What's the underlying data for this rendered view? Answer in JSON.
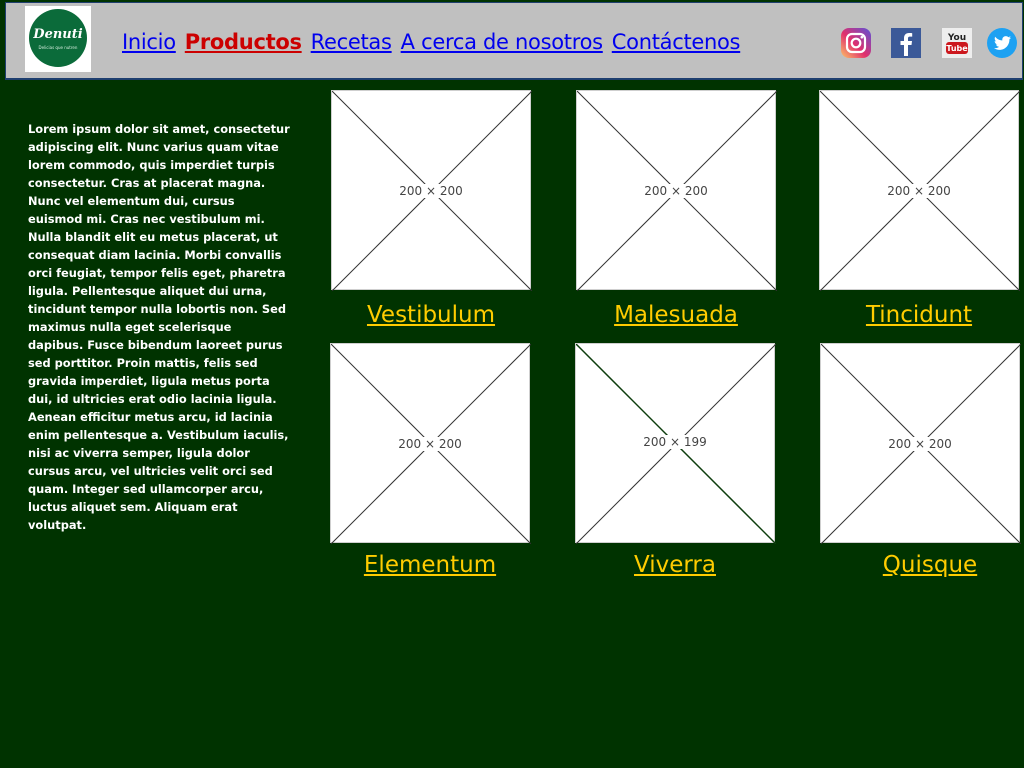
{
  "brand": {
    "name": "Denuti",
    "tagline": "Delicias que nutren"
  },
  "nav": {
    "items": [
      {
        "label": "Inicio",
        "active": false
      },
      {
        "label": "Productos",
        "active": true
      },
      {
        "label": "Recetas",
        "active": false
      },
      {
        "label": "A cerca de nosotros",
        "active": false
      },
      {
        "label": "Contáctenos",
        "active": false
      }
    ]
  },
  "social": [
    {
      "name": "instagram-icon",
      "color": "#c13584"
    },
    {
      "name": "facebook-icon",
      "color": "#3b5998"
    },
    {
      "name": "youtube-icon",
      "color": "#cc181e",
      "label_top": "You",
      "label_bottom": "Tube"
    },
    {
      "name": "twitter-icon",
      "color": "#1da1f2"
    }
  ],
  "sidebar": {
    "text": "Lorem ipsum dolor sit amet, consectetur adipiscing elit. Nunc varius quam vitae lorem commodo, quis imperdiet turpis consectetur. Cras at placerat magna. Nunc vel elementum dui, cursus euismod mi. Cras nec vestibulum mi. Nulla blandit elit eu metus placerat, ut consequat diam lacinia. Morbi convallis orci feugiat, tempor felis eget, pharetra ligula. Pellentesque aliquet dui urna, tincidunt tempor nulla lobortis non. Sed maximus nulla eget scelerisque dapibus. Fusce bibendum laoreet purus sed porttitor. Proin mattis, felis sed gravida imperdiet, ligula metus porta dui, id ultricies erat odio lacinia ligula. Aenean efficitur metus arcu, id lacinia enim pellentesque a. Vestibulum iaculis, nisi ac viverra semper, ligula dolor cursus arcu, vel ultricies velit orci sed quam. Integer sed ullamcorper arcu, luctus aliquet sem. Aliquam erat volutpat."
  },
  "products": [
    {
      "name": "Vestibulum",
      "image_label": "200 × 200"
    },
    {
      "name": "Malesuada",
      "image_label": "200 × 200"
    },
    {
      "name": "Tincidunt",
      "image_label": "200 × 200"
    },
    {
      "name": "Elementum",
      "image_label": "200 × 200"
    },
    {
      "name": "Viverra",
      "image_label": "200 × 199"
    },
    {
      "name": "Quisque",
      "image_label": "200 × 200"
    }
  ],
  "colors": {
    "page_background": "#003300",
    "header_background": "#c0c0c0",
    "nav_link": "#0000ee",
    "nav_active": "#cc0000",
    "product_link": "#ffcc00"
  }
}
